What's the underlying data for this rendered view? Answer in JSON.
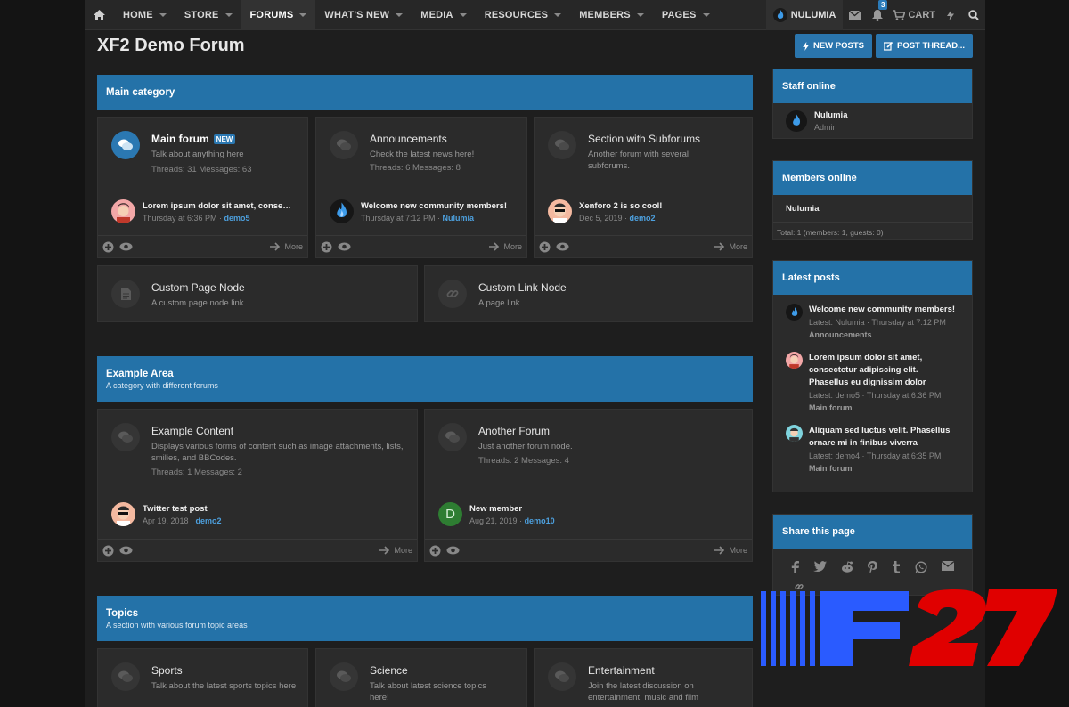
{
  "nav": {
    "items": [
      {
        "label": "HOME",
        "active": false
      },
      {
        "label": "STORE",
        "active": false
      },
      {
        "label": "FORUMS",
        "active": true
      },
      {
        "label": "WHAT'S NEW",
        "active": false
      },
      {
        "label": "MEDIA",
        "active": false
      },
      {
        "label": "RESOURCES",
        "active": false
      },
      {
        "label": "MEMBERS",
        "active": false
      },
      {
        "label": "PAGES",
        "active": false
      }
    ],
    "user": "NULUMIA",
    "alerts_count": "3",
    "cart_label": "CART"
  },
  "header": {
    "title": "XF2 Demo Forum",
    "new_posts": "NEW POSTS",
    "post_thread": "POST THREAD..."
  },
  "main_category": {
    "title": "Main category",
    "nodes": [
      {
        "title": "Main forum",
        "tag": "NEW",
        "desc": "Talk about anything here",
        "stats": "Threads: 31 Messages: 63",
        "last_title": "Lorem ipsum dolor sit amet, consect...",
        "last_date": "Thursday at 6:36 PM",
        "last_user": "demo5",
        "more": "More"
      },
      {
        "title": "Announcements",
        "desc": "Check the latest news here!",
        "stats": "Threads: 6 Messages: 8",
        "last_title": "Welcome new community members!",
        "last_date": "Thursday at 7:12 PM",
        "last_user": "Nulumia",
        "more": "More"
      },
      {
        "title": "Section with Subforums",
        "desc": "Another forum with several subforums.",
        "last_title": "Xenforo 2 is so cool!",
        "last_date": "Dec 5, 2019",
        "last_user": "demo2",
        "more": "More"
      }
    ],
    "page_nodes": [
      {
        "title": "Custom Page Node",
        "desc": "A custom page node link"
      },
      {
        "title": "Custom Link Node",
        "desc": "A page link"
      }
    ]
  },
  "example_area": {
    "title": "Example Area",
    "desc": "A category with different forums",
    "nodes": [
      {
        "title": "Example Content",
        "desc": "Displays various forms of content such as image attachments, lists, smilies, and BBCodes.",
        "stats": "Threads: 1 Messages: 2",
        "last_title": "Twitter test post",
        "last_date": "Apr 19, 2018",
        "last_user": "demo2",
        "more": "More"
      },
      {
        "title": "Another Forum",
        "desc": "Just another forum node.",
        "stats": "Threads: 2 Messages: 4",
        "last_title": "New member",
        "last_date": "Aug 21, 2019",
        "last_user": "demo10",
        "avatar_letter": "D",
        "more": "More"
      }
    ]
  },
  "topics": {
    "title": "Topics",
    "desc": "A section with various forum topic areas",
    "nodes": [
      {
        "title": "Sports",
        "desc": "Talk about the latest sports topics here"
      },
      {
        "title": "Science",
        "desc": "Talk about latest science topics here!"
      },
      {
        "title": "Entertainment",
        "desc": "Join the latest discussion on entertainment, music and film"
      }
    ]
  },
  "sidebar": {
    "staff": {
      "title": "Staff online",
      "name": "Nulumia",
      "role": "Admin"
    },
    "members": {
      "title": "Members online",
      "name": "Nulumia",
      "total": "Total: 1 (members: 1, guests: 0)"
    },
    "latest": {
      "title": "Latest posts",
      "posts": [
        {
          "title": "Welcome new community members!",
          "meta": "Latest: Nulumia · Thursday at 7:12 PM",
          "forum": "Announcements"
        },
        {
          "title": "Lorem ipsum dolor sit amet, consectetur adipiscing elit. Phasellus eu dignissim dolor",
          "meta": "Latest: demo5 · Thursday at 6:36 PM",
          "forum": "Main forum"
        },
        {
          "title": "Aliquam sed luctus velit. Phasellus ornare mi in finibus viverra",
          "meta": "Latest: demo4 · Thursday at 6:35 PM",
          "forum": "Main forum"
        }
      ]
    },
    "share": {
      "title": "Share this page"
    }
  },
  "logo": {
    "text": "F27"
  },
  "colors": {
    "accent": "#2472a8",
    "bg": "#1e1e1e",
    "panel": "#2b2b2b",
    "link": "#4da0de"
  }
}
